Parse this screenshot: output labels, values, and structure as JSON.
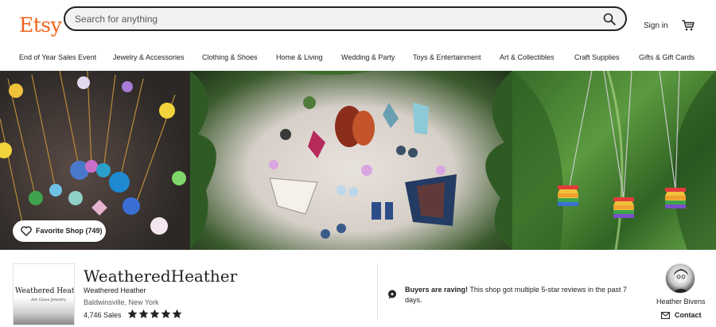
{
  "header": {
    "logo": "Etsy",
    "search_placeholder": "Search for anything",
    "signin_label": "Sign in",
    "icons": {
      "search": "search-icon",
      "cart": "cart-icon"
    }
  },
  "nav": {
    "items": [
      "End of Year Sales Event",
      "Jewelry & Accessories",
      "Clothing & Shoes",
      "Home & Living",
      "Wedding & Party",
      "Toys & Entertainment",
      "Art & Collectibles",
      "Craft Supplies",
      "Gifts & Gift Cards"
    ]
  },
  "banner": {
    "favorite_label": "Favorite Shop (749)"
  },
  "shop": {
    "logo_line1": "Weathered Heather",
    "logo_line2": "Art Glass Jewelry",
    "name": "WeatheredHeather",
    "subtitle": "Weathered Heather",
    "location": "Baldwinsville, New York",
    "sales": "4,746 Sales",
    "rating_stars": 5
  },
  "reviews": {
    "headline": "Buyers are raving!",
    "text": " This shop got multiple 5-star reviews in the past 7 days."
  },
  "owner": {
    "name": "Heather Bivens",
    "contact_label": "Contact"
  },
  "colors": {
    "brand": "#f1641e",
    "text": "#222222",
    "muted": "#595959"
  }
}
